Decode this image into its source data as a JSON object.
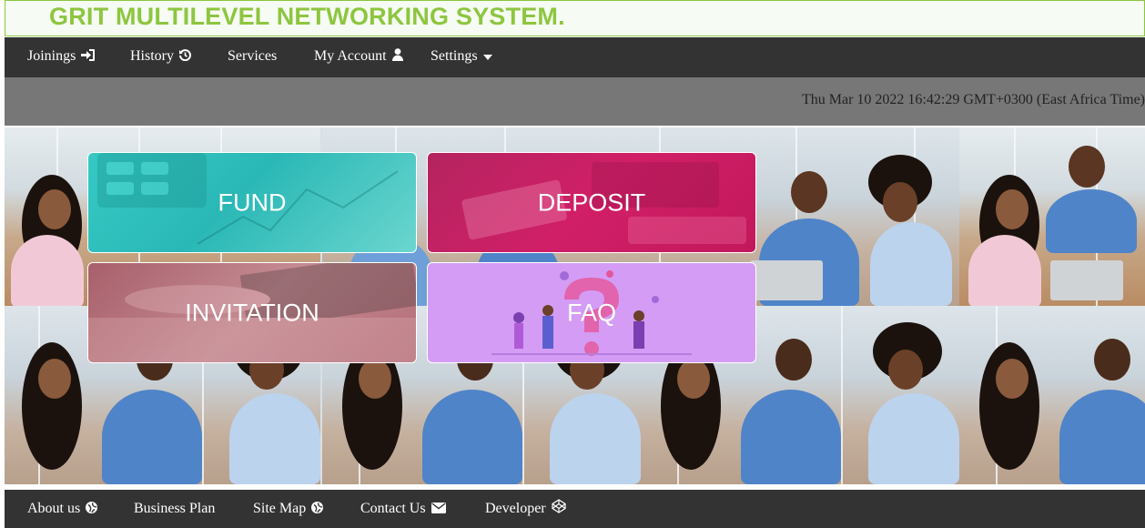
{
  "header": {
    "title": "GRIT MULTILEVEL NETWORKING SYSTEM."
  },
  "nav": {
    "items": [
      {
        "label": "Joinings",
        "icon": "sign-in-icon"
      },
      {
        "label": "History",
        "icon": "history-icon"
      },
      {
        "label": "Services",
        "icon": ""
      },
      {
        "label": "My Account",
        "icon": "user-icon"
      },
      {
        "label": "Settings",
        "icon": "caret-down-icon"
      }
    ]
  },
  "datetime": "Thu Mar 10 2022 16:42:29 GMT+0300 (East Africa Time)",
  "cards": [
    {
      "label": "FUND",
      "color": "#36c9c4"
    },
    {
      "label": "DEPOSIT",
      "color": "#d11f67"
    },
    {
      "label": "INVITATION",
      "color": "#c48a92"
    },
    {
      "label": "FAQ",
      "color": "#d49cf5"
    }
  ],
  "footer": {
    "items": [
      {
        "label": "About us",
        "icon": "globe-icon"
      },
      {
        "label": "Business Plan",
        "icon": ""
      },
      {
        "label": "Site Map",
        "icon": "globe-icon"
      },
      {
        "label": "Contact Us",
        "icon": "envelope-icon"
      },
      {
        "label": "Developer",
        "icon": "codepen-icon"
      }
    ]
  },
  "colors": {
    "brand_green": "#8dc63f",
    "nav_bg": "#333333",
    "datebar_bg": "#777777"
  }
}
